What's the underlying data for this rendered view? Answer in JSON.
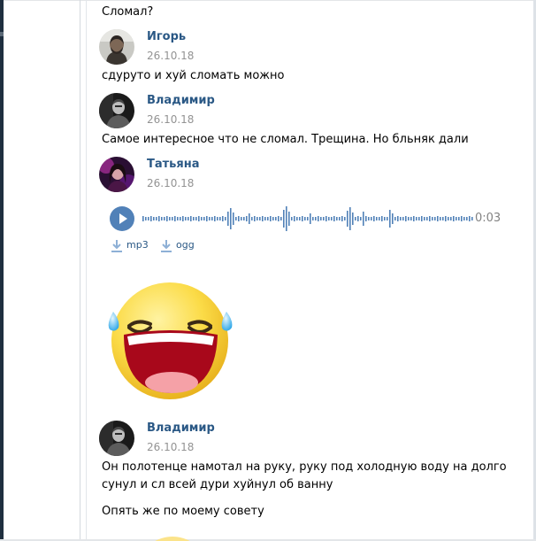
{
  "messages": {
    "top_text": "Сломал?",
    "m1": {
      "author": "Игорь",
      "date": "26.10.18",
      "text": "сдуруто и хуй сломать можно"
    },
    "m2": {
      "author": "Владимир",
      "date": "26.10.18",
      "text": "Самое интересное что не сломал. Трещина. Но бльняк дали"
    },
    "m3": {
      "author": "Татьяна",
      "date": "26.10.18",
      "audio": {
        "duration": "0:03",
        "downloads": [
          {
            "label": "mp3"
          },
          {
            "label": "ogg"
          }
        ]
      }
    },
    "m4": {
      "author": "Владимир",
      "date": "26.10.18",
      "text_line_1": "Он полотенце намотал на руку, руку под холодную воду на долго",
      "text_line_2": "сунул и сл всей дури хуйнул об ванну",
      "text_2": "Опять же по моему совету"
    }
  },
  "colors": {
    "author_link": "#2a5885",
    "date_gray": "#939393",
    "play_button": "#5181b8",
    "waveform": "#5181b8",
    "download_icon": "#8eb0d6"
  },
  "icons": {
    "play": "play-icon",
    "download": "download-icon",
    "sticker": "laughing-tears-emoji"
  }
}
